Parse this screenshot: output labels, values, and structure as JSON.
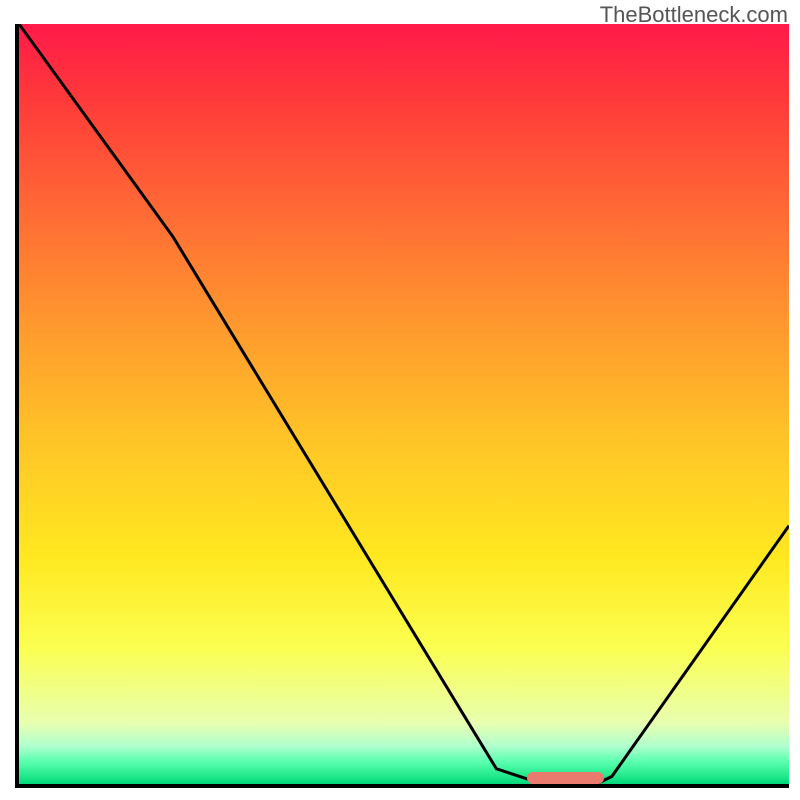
{
  "watermark": "TheBottleneck.com",
  "chart_data": {
    "type": "line",
    "title": "",
    "xlabel": "",
    "ylabel": "",
    "xlim": [
      0,
      100
    ],
    "ylim": [
      0,
      100
    ],
    "curve": [
      {
        "x": 0,
        "y": 100
      },
      {
        "x": 20,
        "y": 72
      },
      {
        "x": 62,
        "y": 2
      },
      {
        "x": 68,
        "y": 0
      },
      {
        "x": 75,
        "y": 0
      },
      {
        "x": 77,
        "y": 1
      },
      {
        "x": 100,
        "y": 34
      }
    ],
    "marker_x_range": [
      66,
      76
    ],
    "marker_y": 0.8,
    "gradient_colors": [
      {
        "pos": 0,
        "color": "#ff1a4a"
      },
      {
        "pos": 10,
        "color": "#ff3a3a"
      },
      {
        "pos": 25,
        "color": "#ff6b35"
      },
      {
        "pos": 40,
        "color": "#ff9a2e"
      },
      {
        "pos": 55,
        "color": "#ffc527"
      },
      {
        "pos": 70,
        "color": "#ffe820"
      },
      {
        "pos": 82,
        "color": "#fbff50"
      },
      {
        "pos": 92,
        "color": "#e8ffb0"
      },
      {
        "pos": 95,
        "color": "#b0ffce"
      },
      {
        "pos": 97,
        "color": "#5cffb0"
      },
      {
        "pos": 99,
        "color": "#20e88a"
      },
      {
        "pos": 100,
        "color": "#00d67a"
      }
    ]
  }
}
